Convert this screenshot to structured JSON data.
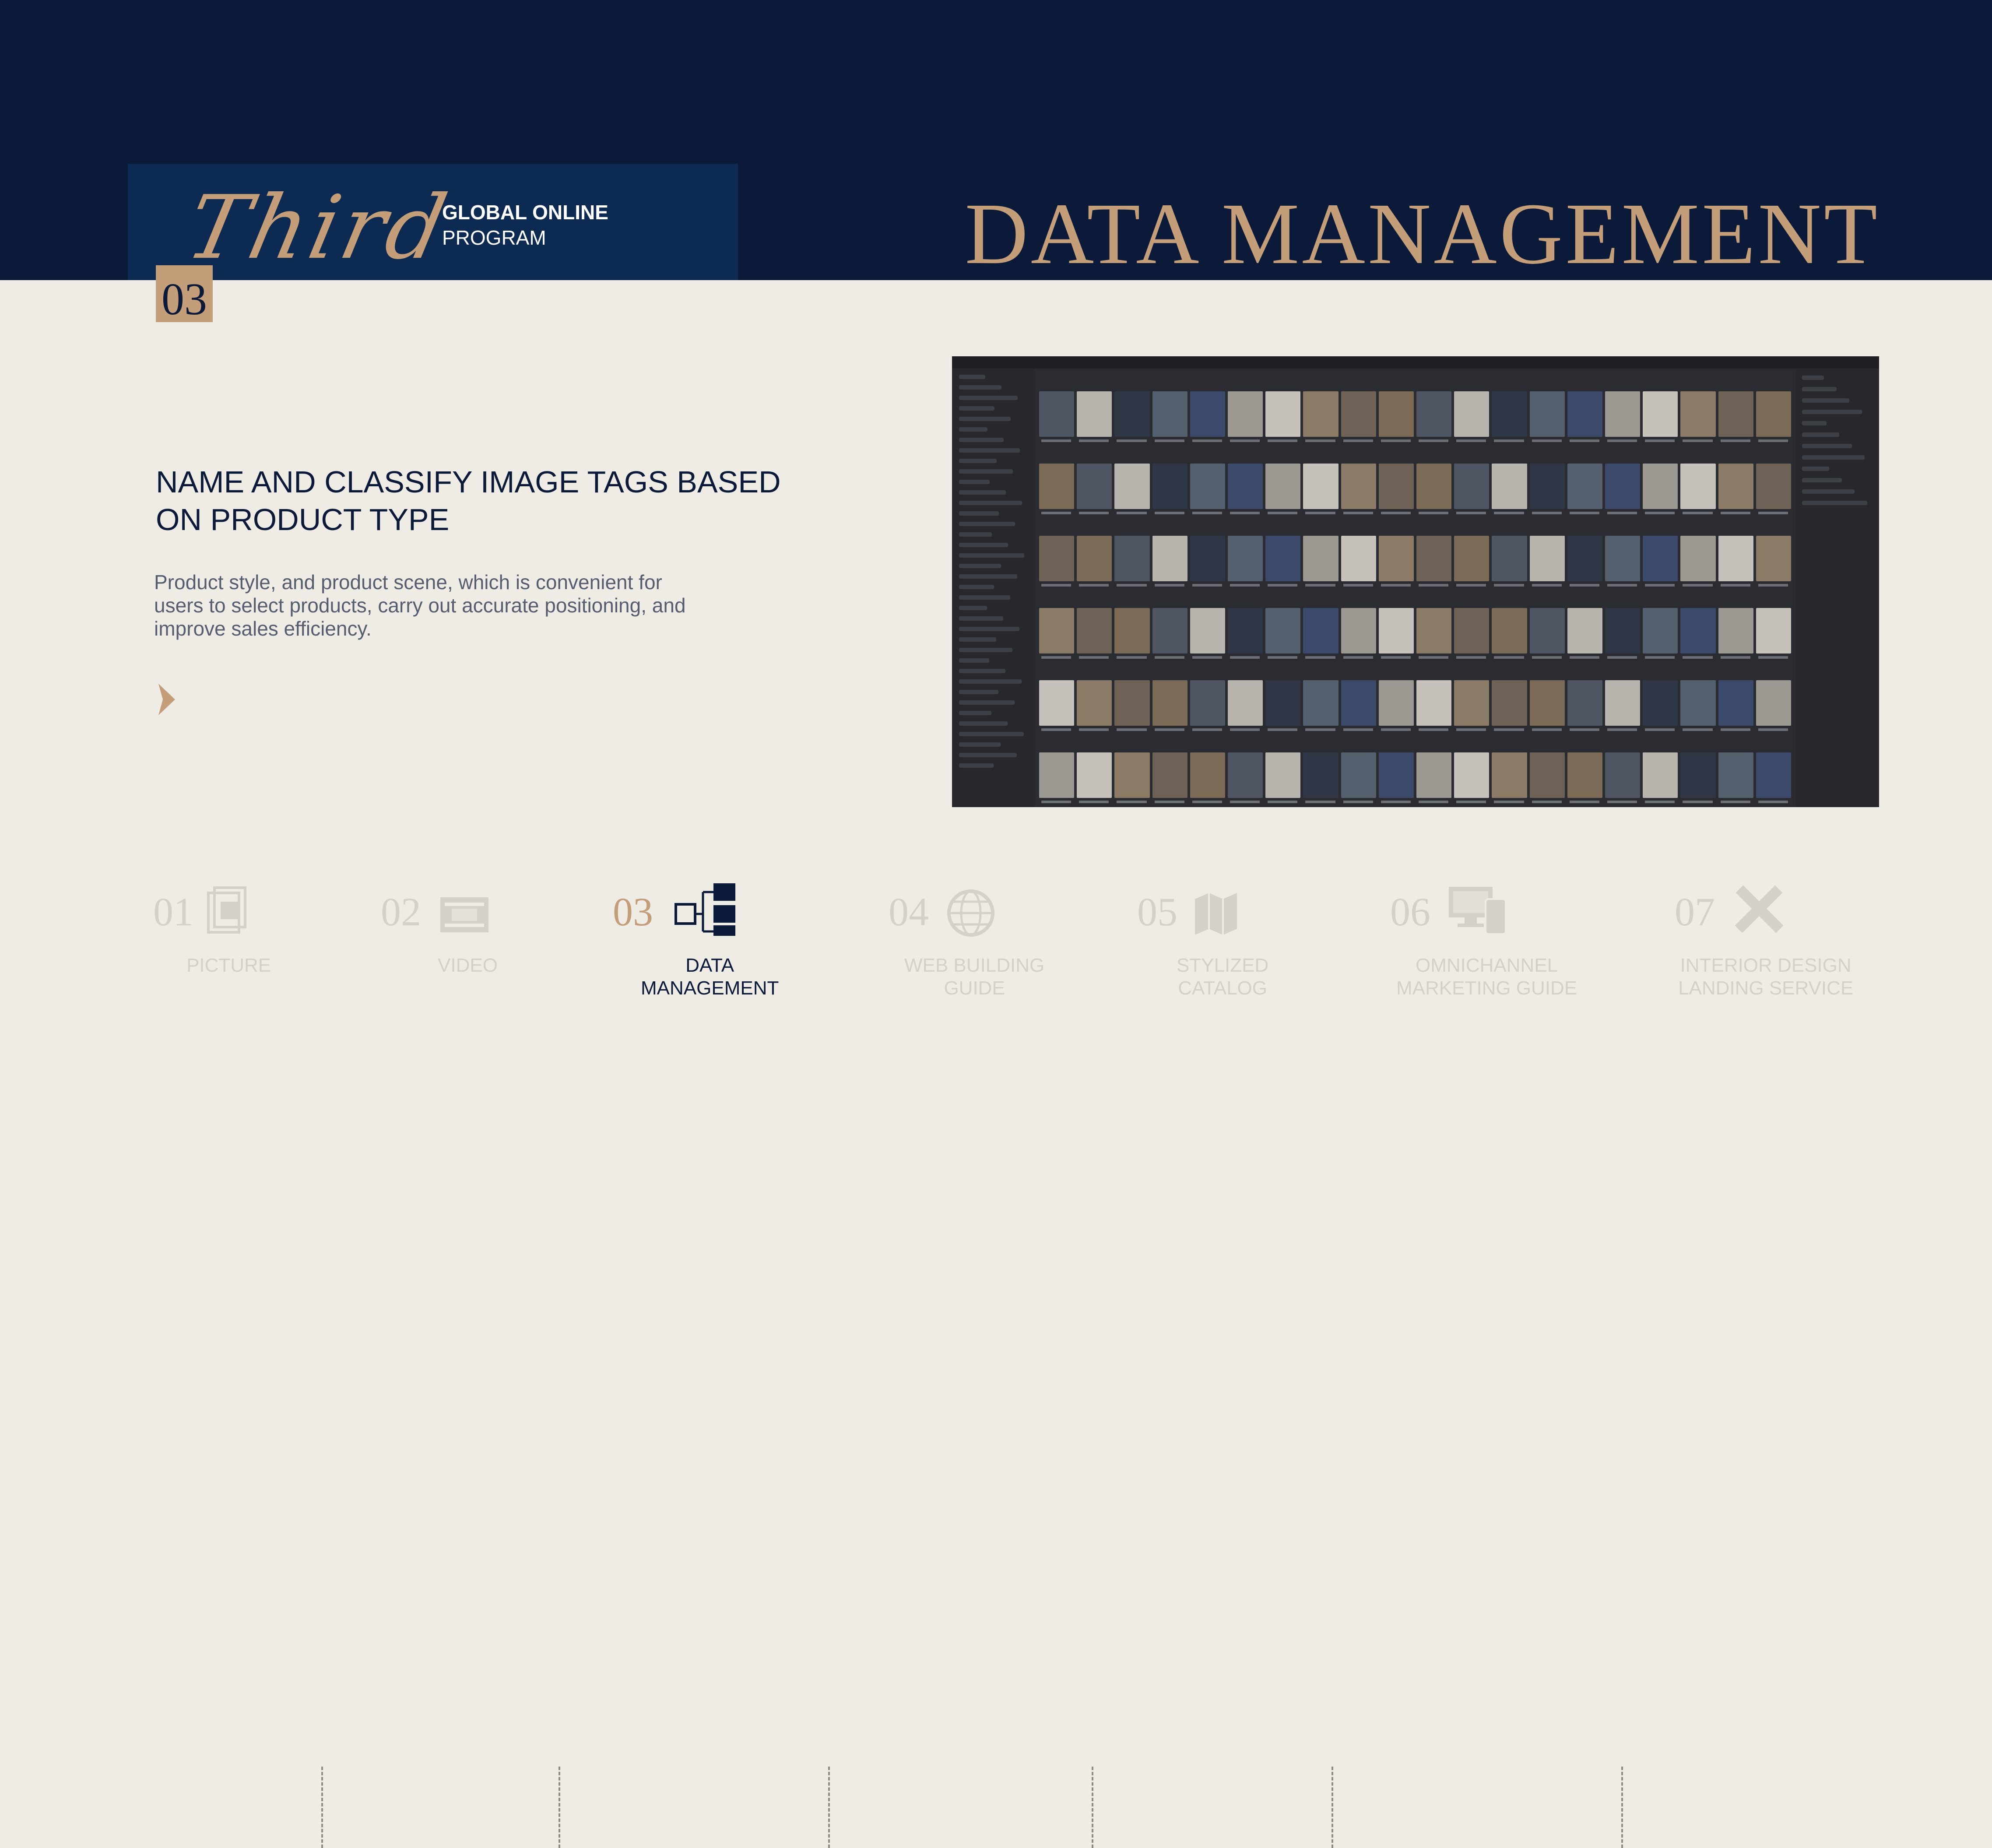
{
  "header": {
    "script_word": "Third",
    "program_line1": "GLOBAL ONLINE",
    "program_line2": "PROGRAM",
    "section_number": "03",
    "title": "DATA MANAGEMENT"
  },
  "content": {
    "heading": "NAME AND CLASSIFY IMAGE TAGS BASED ON PRODUCT TYPE",
    "body": "Product style, and product scene, which is convenient for users to select products, carry out accurate positioning, and improve sales efficiency."
  },
  "nav": {
    "items": [
      {
        "number": "01",
        "label": "PICTURE",
        "icon": "picture-icon"
      },
      {
        "number": "02",
        "label": "VIDEO",
        "icon": "video-icon"
      },
      {
        "number": "03",
        "label": "DATA MANAGEMENT",
        "icon": "data-management-icon"
      },
      {
        "number": "04",
        "label": "WEB BUILDING GUIDE",
        "icon": "globe-icon"
      },
      {
        "number": "05",
        "label": "STYLIZED CATALOG",
        "icon": "catalog-icon"
      },
      {
        "number": "06",
        "label": "OMNICHANNEL MARKETING GUIDE",
        "icon": "devices-icon"
      },
      {
        "number": "07",
        "label": "INTERIOR DESIGN LANDING SERVICE",
        "icon": "ruler-pencil-icon"
      }
    ],
    "active_index": 2
  },
  "colors": {
    "navy": "#0c1a39",
    "navy_box": "#0d2a52",
    "gold": "#c39e79",
    "background": "#efece6",
    "muted": "#d4d0ca"
  }
}
